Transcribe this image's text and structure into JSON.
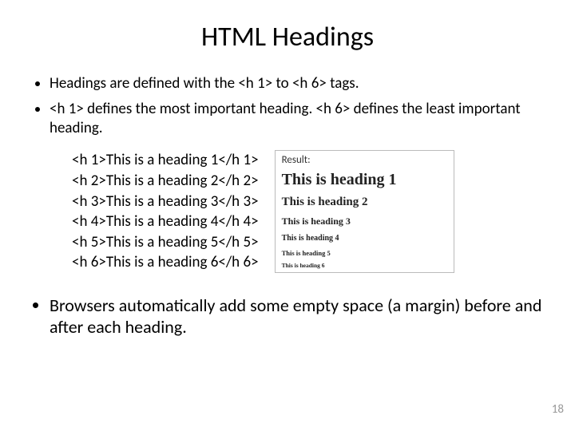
{
  "title": "HTML Headings",
  "bullets_top": [
    "Headings are defined with the <h 1> to <h 6> tags.",
    "<h 1> defines the most important heading. <h 6> defines the least important heading."
  ],
  "code_lines": [
    "<h 1>This is a heading 1</h 1>",
    "<h 2>This is a heading 2</h 2>",
    "<h 3>This is a heading 3</h 3>",
    "<h 4>This is a heading 4</h 4>",
    "<h 5>This is a heading 5</h 5>",
    "<h 6>This is a heading 6</h 6>"
  ],
  "result": {
    "label": "Result:",
    "h1": "This is heading 1",
    "h2": "This is heading 2",
    "h3": "This is heading 3",
    "h4": "This is heading 4",
    "h5": "This is heading 5",
    "h6": "This is heading 6"
  },
  "bullets_bottom": [
    "Browsers automatically add some empty space (a margin) before and after each heading."
  ],
  "page_number": "18"
}
